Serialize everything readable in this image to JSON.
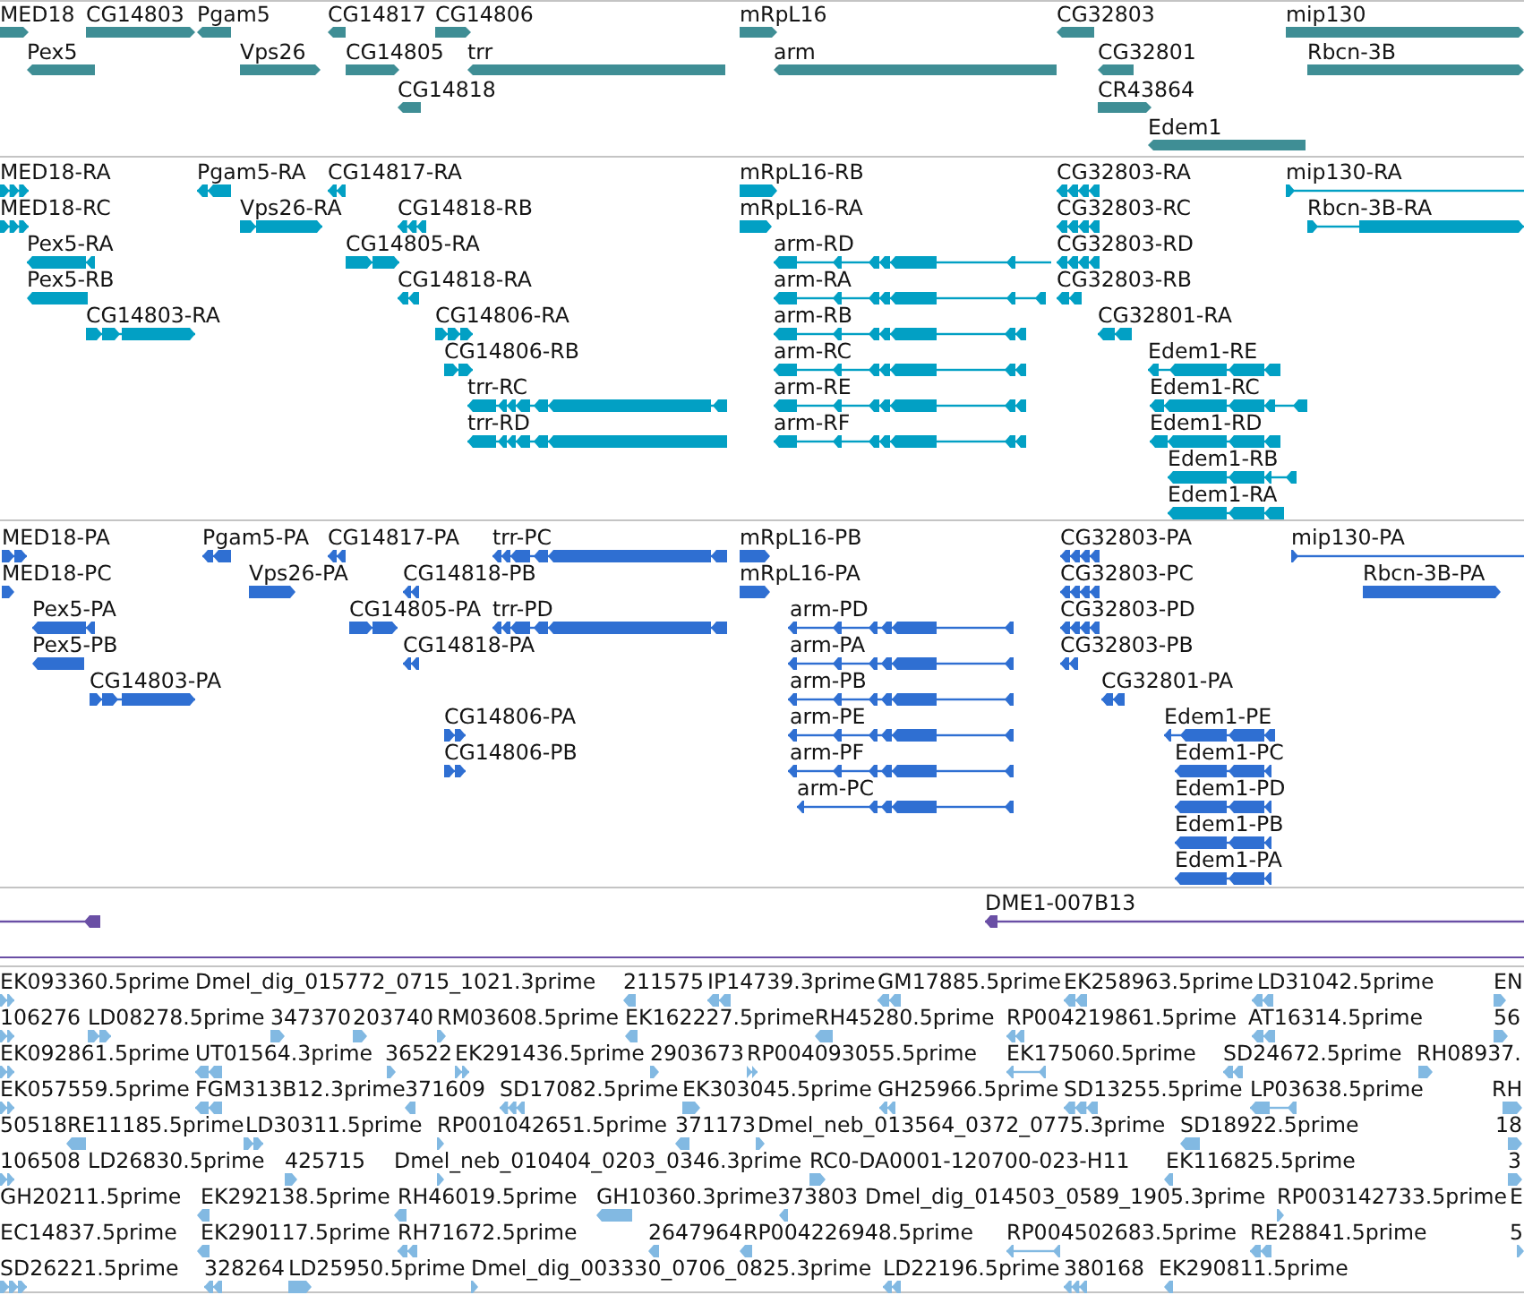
{
  "tracks": [
    {
      "kind": "genes",
      "features": [
        {
          "label": "MED18",
          "reverse": false
        },
        {
          "label": "CG14803",
          "reverse": false
        },
        {
          "label": "Pgam5",
          "reverse": true
        },
        {
          "label": "CG14817",
          "reverse": true
        },
        {
          "label": "CG14806",
          "reverse": false
        },
        {
          "label": "mRpL16",
          "reverse": false
        },
        {
          "label": "CG32803",
          "reverse": true
        },
        {
          "label": "mip130",
          "reverse": false
        },
        {
          "label": "Pex5",
          "reverse": true
        },
        {
          "label": "Vps26",
          "reverse": false
        },
        {
          "label": "CG14805",
          "reverse": false
        },
        {
          "label": "trr",
          "reverse": true
        },
        {
          "label": "arm",
          "reverse": true
        },
        {
          "label": "CG32801",
          "reverse": true
        },
        {
          "label": "Rbcn-3B",
          "reverse": false
        },
        {
          "label": "CG14818",
          "reverse": true
        },
        {
          "label": "CR43864",
          "reverse": false
        },
        {
          "label": "Edem1",
          "reverse": true
        }
      ]
    },
    {
      "kind": "transcripts",
      "features": [
        {
          "label": "MED18-RA",
          "reverse": false
        },
        {
          "label": "Pgam5-RA",
          "reverse": true
        },
        {
          "label": "CG14817-RA",
          "reverse": true
        },
        {
          "label": "mRpL16-RB",
          "reverse": false
        },
        {
          "label": "CG32803-RA",
          "reverse": true
        },
        {
          "label": "mip130-RA",
          "reverse": false
        },
        {
          "label": "MED18-RC",
          "reverse": false
        },
        {
          "label": "Vps26-RA",
          "reverse": false
        },
        {
          "label": "CG14818-RB",
          "reverse": true
        },
        {
          "label": "mRpL16-RA",
          "reverse": false
        },
        {
          "label": "CG32803-RC",
          "reverse": true
        },
        {
          "label": "Rbcn-3B-RA",
          "reverse": false
        },
        {
          "label": "Pex5-RA",
          "reverse": true
        },
        {
          "label": "CG14805-RA",
          "reverse": false
        },
        {
          "label": "arm-RD",
          "reverse": true
        },
        {
          "label": "CG32803-RD",
          "reverse": true
        },
        {
          "label": "Pex5-RB",
          "reverse": true
        },
        {
          "label": "CG14818-RA",
          "reverse": true
        },
        {
          "label": "arm-RA",
          "reverse": true
        },
        {
          "label": "CG32803-RB",
          "reverse": true
        },
        {
          "label": "CG14803-RA",
          "reverse": false
        },
        {
          "label": "CG14806-RA",
          "reverse": false
        },
        {
          "label": "arm-RB",
          "reverse": true
        },
        {
          "label": "CG32801-RA",
          "reverse": true
        },
        {
          "label": "CG14806-RB",
          "reverse": false
        },
        {
          "label": "arm-RC",
          "reverse": true
        },
        {
          "label": "Edem1-RE",
          "reverse": true
        },
        {
          "label": "trr-RC",
          "reverse": true
        },
        {
          "label": "arm-RE",
          "reverse": true
        },
        {
          "label": "Edem1-RC",
          "reverse": true
        },
        {
          "label": "trr-RD",
          "reverse": true
        },
        {
          "label": "arm-RF",
          "reverse": true
        },
        {
          "label": "Edem1-RD",
          "reverse": true
        },
        {
          "label": "Edem1-RB",
          "reverse": true
        },
        {
          "label": "Edem1-RA",
          "reverse": true
        }
      ]
    },
    {
      "kind": "proteins",
      "features": [
        {
          "label": "MED18-PA",
          "reverse": false
        },
        {
          "label": "Pgam5-PA",
          "reverse": true
        },
        {
          "label": "CG14817-PA",
          "reverse": true
        },
        {
          "label": "trr-PC",
          "reverse": true
        },
        {
          "label": "mRpL16-PB",
          "reverse": false
        },
        {
          "label": "CG32803-PA",
          "reverse": true
        },
        {
          "label": "mip130-PA",
          "reverse": false
        },
        {
          "label": "MED18-PC",
          "reverse": false
        },
        {
          "label": "Vps26-PA",
          "reverse": false
        },
        {
          "label": "CG14818-PB",
          "reverse": true
        },
        {
          "label": "mRpL16-PA",
          "reverse": false
        },
        {
          "label": "CG32803-PC",
          "reverse": true
        },
        {
          "label": "Rbcn-3B-PA",
          "reverse": false
        },
        {
          "label": "Pex5-PA",
          "reverse": true
        },
        {
          "label": "CG14805-PA",
          "reverse": false
        },
        {
          "label": "trr-PD",
          "reverse": true
        },
        {
          "label": "arm-PD",
          "reverse": true
        },
        {
          "label": "CG32803-PD",
          "reverse": true
        },
        {
          "label": "Pex5-PB",
          "reverse": true
        },
        {
          "label": "CG14818-PA",
          "reverse": true
        },
        {
          "label": "arm-PA",
          "reverse": true
        },
        {
          "label": "CG32803-PB",
          "reverse": true
        },
        {
          "label": "CG14803-PA",
          "reverse": false
        },
        {
          "label": "arm-PB",
          "reverse": true
        },
        {
          "label": "CG32801-PA",
          "reverse": true
        },
        {
          "label": "CG14806-PA",
          "reverse": false
        },
        {
          "label": "arm-PE",
          "reverse": true
        },
        {
          "label": "Edem1-PE",
          "reverse": true
        },
        {
          "label": "CG14806-PB",
          "reverse": false
        },
        {
          "label": "arm-PF",
          "reverse": true
        },
        {
          "label": "Edem1-PC",
          "reverse": true
        },
        {
          "label": "arm-PC",
          "reverse": true
        },
        {
          "label": "Edem1-PD",
          "reverse": true
        },
        {
          "label": "Edem1-PB",
          "reverse": true
        },
        {
          "label": "Edem1-PA",
          "reverse": true
        }
      ]
    },
    {
      "kind": "clones",
      "features": [
        {
          "reverse": true
        },
        {
          "label": "DME1-007B13",
          "reverse": true
        }
      ]
    },
    {
      "kind": "ests",
      "features": [
        {
          "label": "EK093360.5prime",
          "reverse": false
        },
        {
          "label": "Dmel_dig_015772_0715_1021.3prime"
        },
        {
          "label": "211575",
          "reverse": true
        },
        {
          "label": "IP14739.3prime",
          "reverse": true
        },
        {
          "label": "GM17885.5prime",
          "reverse": true
        },
        {
          "label": "EK258963.5prime",
          "reverse": true
        },
        {
          "label": "LD31042.5prime",
          "reverse": true
        },
        {
          "label": "EN",
          "reverse": false
        },
        {
          "label": "106276",
          "reverse": false
        },
        {
          "label": "LD08278.5prime",
          "reverse": false
        },
        {
          "label": "347370",
          "reverse": false
        },
        {
          "label": "203740",
          "reverse": false
        },
        {
          "label": "RM03608.5prime",
          "reverse": false
        },
        {
          "label": "EK162227.5prime",
          "reverse": true
        },
        {
          "label": "RH45280.5prime",
          "reverse": true
        },
        {
          "label": "RP004219861.5prime",
          "reverse": true
        },
        {
          "label": "AT16314.5prime",
          "reverse": true
        },
        {
          "label": "56",
          "reverse": false
        },
        {
          "label": "EK092861.5prime",
          "reverse": false
        },
        {
          "label": "UT01564.3prime",
          "reverse": true
        },
        {
          "label": "36522",
          "reverse": false
        },
        {
          "label": "EK291436.5prime",
          "reverse": false
        },
        {
          "label": "2903673",
          "reverse": false
        },
        {
          "label": "RP004093055.5prime",
          "reverse": false
        },
        {
          "label": "EK175060.5prime",
          "reverse": true
        },
        {
          "label": "SD24672.5prime",
          "reverse": true
        },
        {
          "label": "RH08937.",
          "reverse": false
        },
        {
          "label": "EK057559.5prime",
          "reverse": false
        },
        {
          "label": "FGM313B12.3prime",
          "reverse": true
        },
        {
          "label": "371609",
          "reverse": true
        },
        {
          "label": "SD17082.5prime",
          "reverse": true
        },
        {
          "label": "EK303045.5prime",
          "reverse": false
        },
        {
          "label": "GH25966.5prime",
          "reverse": true
        },
        {
          "label": "SD13255.5prime",
          "reverse": true
        },
        {
          "label": "LP03638.5prime",
          "reverse": true
        },
        {
          "label": "RH",
          "reverse": false
        },
        {
          "label": "50518"
        },
        {
          "label": "RE11185.5prime",
          "reverse": true
        },
        {
          "label": "LD30311.5prime",
          "reverse": false
        },
        {
          "label": "RP001042651.5prime",
          "reverse": false
        },
        {
          "label": "371173",
          "reverse": true
        },
        {
          "label": "Dmel_neb_013564_0372_0775.3prime",
          "reverse": false
        },
        {
          "label": "SD18922.5prime",
          "reverse": true
        },
        {
          "label": "18",
          "reverse": false
        },
        {
          "label": "106508",
          "reverse": false
        },
        {
          "label": "LD26830.5prime"
        },
        {
          "label": "425715",
          "reverse": false
        },
        {
          "label": "Dmel_neb_010404_0203_0346.3prime",
          "reverse": false
        },
        {
          "label": "RC0-DA0001-120700-023-H11",
          "reverse": false
        },
        {
          "label": "EK116825.5prime",
          "reverse": true
        },
        {
          "label": "3",
          "reverse": false
        },
        {
          "label": "GH20211.5prime"
        },
        {
          "label": "EK292138.5prime",
          "reverse": true
        },
        {
          "label": "RH46019.5prime",
          "reverse": true
        },
        {
          "label": "GH10360.3prime",
          "reverse": true
        },
        {
          "label": "373803",
          "reverse": true
        },
        {
          "label": "Dmel_dig_014503_0589_1905.3prime"
        },
        {
          "label": "RP003142733.5prime",
          "reverse": false
        },
        {
          "label": "E"
        },
        {
          "label": "EC14837.5prime"
        },
        {
          "label": "EK290117.5prime",
          "reverse": true
        },
        {
          "label": "RH71672.5prime",
          "reverse": true
        },
        {
          "label": "2647964",
          "reverse": true
        },
        {
          "label": "RP004226948.5prime",
          "reverse": true
        },
        {
          "label": "RP004502683.5prime",
          "reverse": true
        },
        {
          "label": "RE28841.5prime",
          "reverse": true
        },
        {
          "label": "5",
          "reverse": false
        },
        {
          "label": "SD26221.5prime",
          "reverse": false
        },
        {
          "label": "328264",
          "reverse": true
        },
        {
          "label": "LD25950.5prime",
          "reverse": false
        },
        {
          "label": "Dmel_dig_003330_0706_0825.3prime",
          "reverse": false
        },
        {
          "label": "LD22196.5prime",
          "reverse": true
        },
        {
          "label": "380168",
          "reverse": true
        },
        {
          "label": "EK290811.5prime",
          "reverse": true
        }
      ]
    }
  ]
}
